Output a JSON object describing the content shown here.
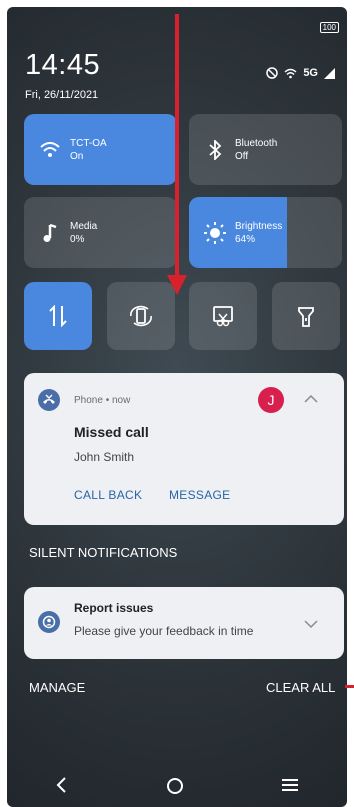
{
  "status_bar": {
    "battery": "100",
    "time": "14:45",
    "date": "Fri, 26/11/2021",
    "network": "5G"
  },
  "quick_settings": {
    "tiles": [
      {
        "label": "TCT-OA",
        "state": "On"
      },
      {
        "label": "Bluetooth",
        "state": "Off"
      },
      {
        "label": "Media",
        "state": "0%"
      },
      {
        "label": "Brightness",
        "state": "64%"
      }
    ],
    "brightness_level": 0.64
  },
  "notification": {
    "app": "Phone • now",
    "avatar_initial": "J",
    "title": "Missed call",
    "subtitle": "John Smith",
    "action1": "CALL BACK",
    "action2": "MESSAGE"
  },
  "silent_label": "SILENT NOTIFICATIONS",
  "report": {
    "title": "Report issues",
    "subtitle": "Please give your feedback in time"
  },
  "footer": {
    "manage": "MANAGE",
    "clear_all": "CLEAR ALL"
  },
  "colors": {
    "accent": "#4a88df",
    "avatar": "#d8204e",
    "link": "#2764a8",
    "annotation_red": "#d8212c"
  }
}
